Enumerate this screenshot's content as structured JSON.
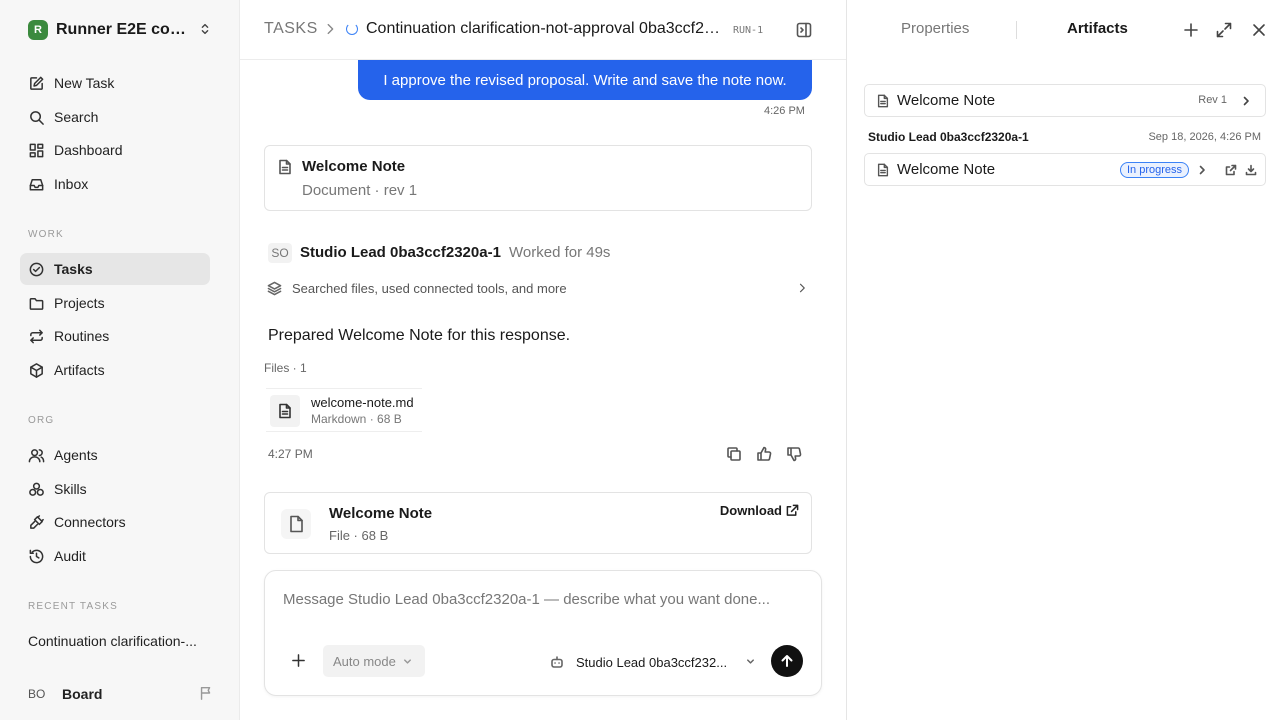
{
  "workspace": {
    "logo_letter": "R",
    "name": "Runner E2E conti..."
  },
  "nav": {
    "primary": [
      {
        "label": "New Task",
        "icon": "edit-icon"
      },
      {
        "label": "Search",
        "icon": "search-icon"
      },
      {
        "label": "Dashboard",
        "icon": "grid-icon"
      },
      {
        "label": "Inbox",
        "icon": "inbox-icon"
      }
    ],
    "work_label": "WORK",
    "work": [
      {
        "label": "Tasks",
        "icon": "check-circle-icon",
        "active": true
      },
      {
        "label": "Projects",
        "icon": "folder-icon"
      },
      {
        "label": "Routines",
        "icon": "repeat-icon"
      },
      {
        "label": "Artifacts",
        "icon": "cube-icon"
      }
    ],
    "org_label": "ORG",
    "org": [
      {
        "label": "Agents",
        "icon": "users-icon"
      },
      {
        "label": "Skills",
        "icon": "skills-icon"
      },
      {
        "label": "Connectors",
        "icon": "plug-icon"
      },
      {
        "label": "Audit",
        "icon": "history-icon"
      }
    ],
    "recent_label": "RECENT TASKS",
    "recent": [
      "Continuation clarification-..."
    ]
  },
  "user": {
    "initials": "BO",
    "name": "Board"
  },
  "header": {
    "root": "TASKS",
    "title": "Continuation clarification-not-approval 0ba3ccf232...",
    "run": "RUN-1"
  },
  "thread": {
    "user_message": "I approve the revised proposal. Write and save the note now.",
    "user_time": "4:26 PM",
    "doc_card": {
      "title": "Welcome Note",
      "subtitle": "Document · rev 1"
    },
    "agent": {
      "initials": "SO",
      "name": "Studio Lead 0ba3ccf2320a-1",
      "worked": "Worked for 49s"
    },
    "activity": "Searched files, used connected tools, and more",
    "response": "Prepared Welcome Note for this response.",
    "files_label": "Files · 1",
    "file": {
      "name": "welcome-note.md",
      "meta": "Markdown · 68 B"
    },
    "agent_time": "4:27 PM",
    "download_card": {
      "title": "Welcome Note",
      "meta": "File · 68 B",
      "action": "Download"
    }
  },
  "composer": {
    "placeholder": "Message Studio Lead 0ba3ccf2320a-1 — describe what you want done...",
    "mode": "Auto mode",
    "agent": "Studio Lead 0ba3ccf232..."
  },
  "right_panel": {
    "tabs": [
      "Properties",
      "Artifacts"
    ],
    "active_tab": "Artifacts",
    "top_artifact": {
      "title": "Welcome Note",
      "rev": "Rev 1"
    },
    "group": {
      "name": "Studio Lead 0ba3ccf2320a-1",
      "date": "Sep 18, 2026, 4:26 PM"
    },
    "group_artifact": {
      "title": "Welcome Note",
      "status": "In progress"
    }
  },
  "colors": {
    "accent": "#2563eb",
    "active_nav": "#e6e6e6",
    "logo": "#3b8a3e"
  }
}
